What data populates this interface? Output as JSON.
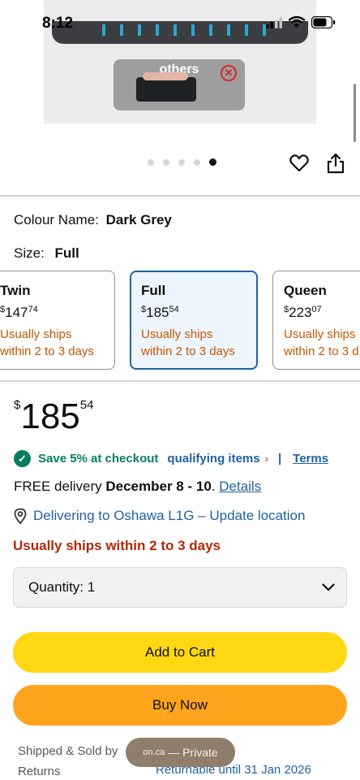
{
  "status_bar": {
    "time": "8:12"
  },
  "hero": {
    "overlay_label": "others"
  },
  "carousel": {
    "count": 5,
    "active_index": 4
  },
  "colour": {
    "label": "Colour Name:",
    "value": "Dark Grey"
  },
  "size": {
    "label": "Size:",
    "value": "Full"
  },
  "size_options": [
    {
      "name": "Twin",
      "currency": "$",
      "whole": "147",
      "fraction": "74",
      "ship_line1": "Usually ships",
      "ship_line2": "within 2 to 3 days",
      "selected": false
    },
    {
      "name": "Full",
      "currency": "$",
      "whole": "185",
      "fraction": "54",
      "ship_line1": "Usually ships",
      "ship_line2": "within 2 to 3 days",
      "selected": true
    },
    {
      "name": "Queen",
      "currency": "$",
      "whole": "223",
      "fraction": "07",
      "ship_line1": "Usually ships",
      "ship_line2": "within 2 to 3 d",
      "selected": false
    }
  ],
  "price": {
    "currency": "$",
    "whole": "185",
    "fraction": "54"
  },
  "promo": {
    "save_text": "Save 5% at checkout",
    "qualifying_link": "qualifying items",
    "separator": "|",
    "terms_link": "Terms"
  },
  "delivery": {
    "prefix": "FREE delivery",
    "date": "December 8 - 10",
    "suffix": ".",
    "details_link": "Details"
  },
  "location": {
    "text": "Delivering to Oshawa L1G – Update location"
  },
  "availability": {
    "text": "Usually ships within 2 to 3 days"
  },
  "quantity": {
    "label": "Quantity:",
    "value": "1"
  },
  "buttons": {
    "add_to_cart": "Add to Cart",
    "buy_now": "Buy Now"
  },
  "footer": {
    "shipped_sold_label": "Shipped & Sold by",
    "returns_label": "Returns",
    "returns_value": "Returnable until 31 Jan 2026"
  },
  "browser_pill": {
    "domain": "on.ca",
    "mode": "— Private"
  },
  "colors": {
    "accent_link": "#2162a1",
    "promo_green": "#067d62",
    "alert_red": "#b12704",
    "ship_orange": "#c45500",
    "cart_yellow": "#ffd814",
    "buy_orange": "#ffa41c",
    "selected_border": "#2162a1"
  }
}
